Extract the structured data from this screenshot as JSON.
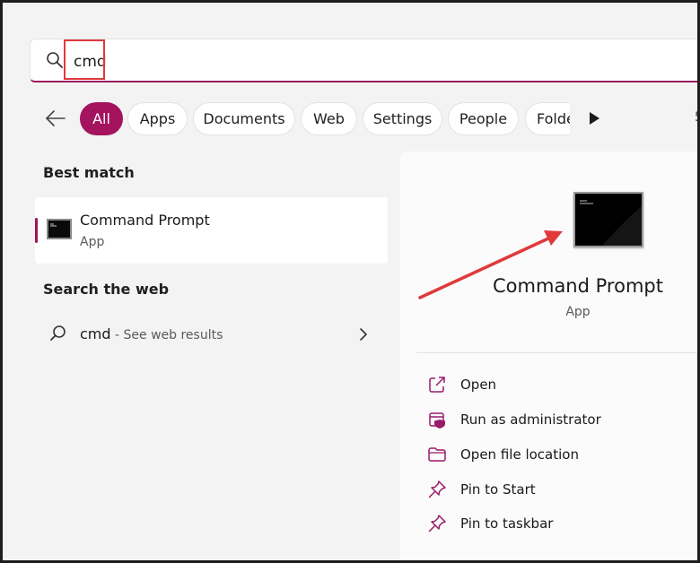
{
  "search": {
    "value": "cmd",
    "icon": "search-icon"
  },
  "filters": {
    "items": [
      {
        "label": "All",
        "active": true
      },
      {
        "label": "Apps"
      },
      {
        "label": "Documents"
      },
      {
        "label": "Web"
      },
      {
        "label": "Settings"
      },
      {
        "label": "People"
      },
      {
        "label": "Folde"
      }
    ],
    "count_fragment": "5"
  },
  "best_match": {
    "heading": "Best match",
    "title": "Command Prompt",
    "subtitle": "App"
  },
  "search_web": {
    "heading": "Search the web",
    "query": "cmd",
    "suffix": " - See web results"
  },
  "detail": {
    "title": "Command Prompt",
    "subtitle": "App",
    "actions": [
      {
        "label": "Open",
        "icon": "open-external-icon"
      },
      {
        "label": "Run as administrator",
        "icon": "admin-shield-icon"
      },
      {
        "label": "Open file location",
        "icon": "folder-icon"
      },
      {
        "label": "Pin to Start",
        "icon": "pin-icon"
      },
      {
        "label": "Pin to taskbar",
        "icon": "pin-icon"
      }
    ]
  },
  "colors": {
    "accent": "#a3135e",
    "annotation": "#e0393b",
    "action_icon": "#9a1a6a"
  }
}
